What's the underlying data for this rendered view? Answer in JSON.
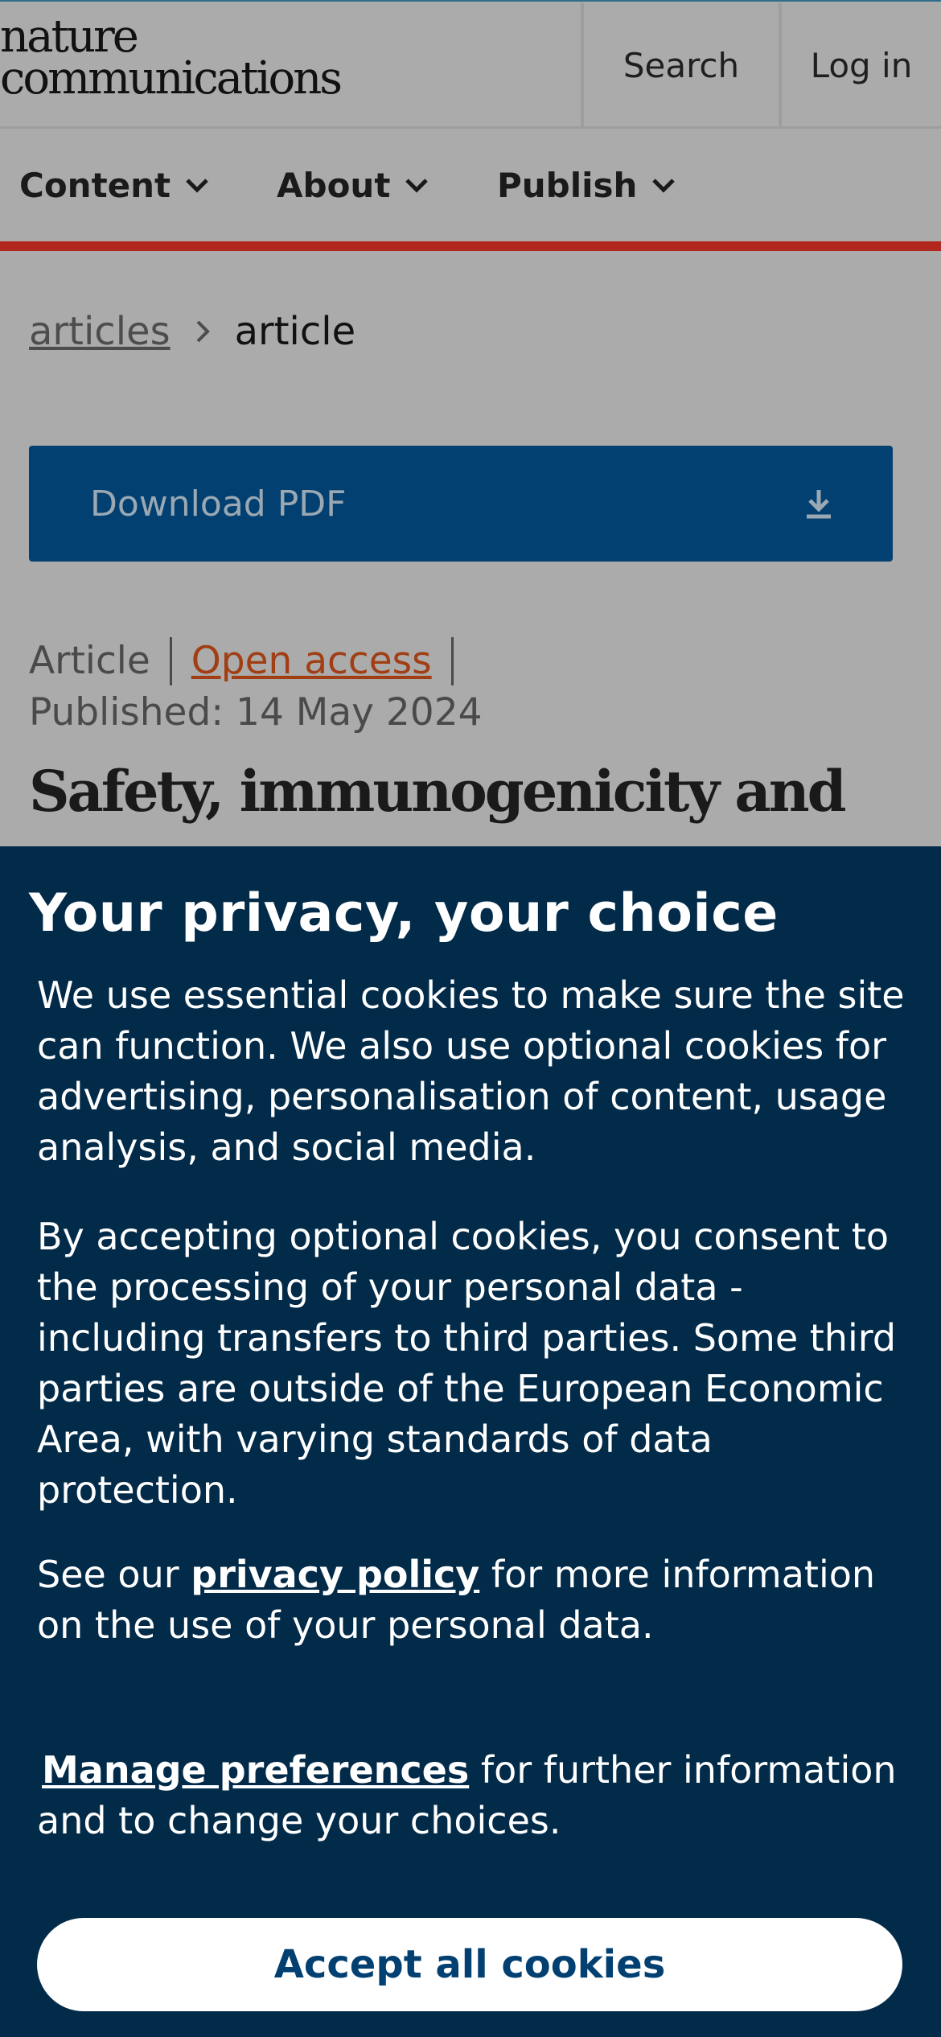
{
  "header": {
    "logo_line1": "nature",
    "logo_line2": "communications",
    "search_label": "Search",
    "login_label": "Log in"
  },
  "nav": {
    "items": [
      {
        "label": "Content"
      },
      {
        "label": "About"
      },
      {
        "label": "Publish"
      }
    ]
  },
  "breadcrumb": {
    "link": "articles",
    "current": "article"
  },
  "download": {
    "label": "Download PDF"
  },
  "article": {
    "type": "Article",
    "access": "Open access",
    "published": "Published: 14 May 2024",
    "title_visible": "Safety, immunogenicity and"
  },
  "cookie_banner": {
    "title": "Your privacy, your choice",
    "paragraph1": "We use essential cookies to make sure the site can function. We also use optional cookies for advertising, personalisation of content, usage analysis, and social media.",
    "paragraph2": "By accepting optional cookies, you consent to the processing of your personal data - including transfers to third parties. Some third parties are outside of the European Economic Area, with varying standards of data protection.",
    "p3_prefix": "See our ",
    "privacy_link": "privacy policy",
    "p3_suffix": " for more information on the use of your personal data.",
    "manage_link": "Manage preferences",
    "p4_suffix": " for further information and to change your choices.",
    "accept_label": "Accept all cookies"
  },
  "colors": {
    "page_bg": "#ababab",
    "accent_red": "#b1271d",
    "pdf_button": "#024071",
    "banner_bg": "#022a49",
    "open_access": "#a13e14"
  }
}
